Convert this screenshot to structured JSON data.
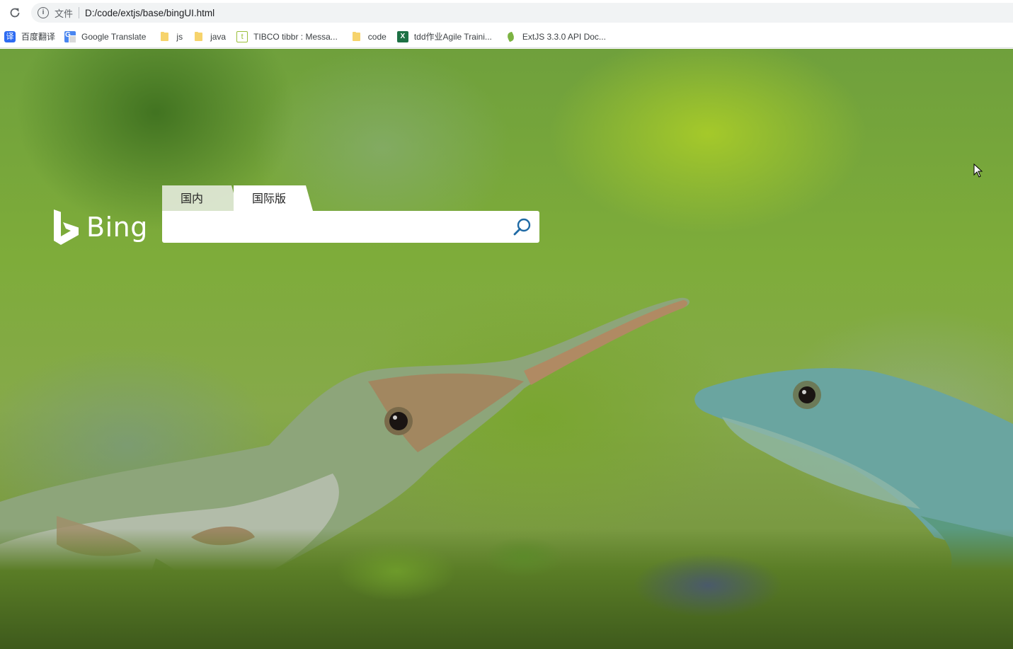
{
  "browser": {
    "file_label": "文件",
    "url": "D:/code/extjs/base/bingUI.html"
  },
  "bookmarks": [
    {
      "label": "百度翻译",
      "icon": "baidu-fanyi-icon",
      "glyph": "译"
    },
    {
      "label": "Google Translate",
      "icon": "google-translate-icon"
    },
    {
      "label": "js",
      "icon": "folder-icon"
    },
    {
      "label": "java",
      "icon": "folder-icon"
    },
    {
      "label": "TIBCO tibbr : Messa...",
      "icon": "tibbr-icon",
      "glyph": "t"
    },
    {
      "label": "code",
      "icon": "folder-icon"
    },
    {
      "label": "tdd作业Agile Traini...",
      "icon": "excel-icon",
      "glyph": "X"
    },
    {
      "label": "ExtJS 3.3.0 API Doc...",
      "icon": "extjs-icon"
    }
  ],
  "bing": {
    "logo_text": "Bing",
    "tabs": [
      {
        "label": "国内版",
        "active": false
      },
      {
        "label": "国际版",
        "active": true
      }
    ],
    "search": {
      "value": "",
      "placeholder": ""
    }
  },
  "colors": {
    "search_icon": "#1f6aa5",
    "bing_logo": "#ffffff"
  }
}
